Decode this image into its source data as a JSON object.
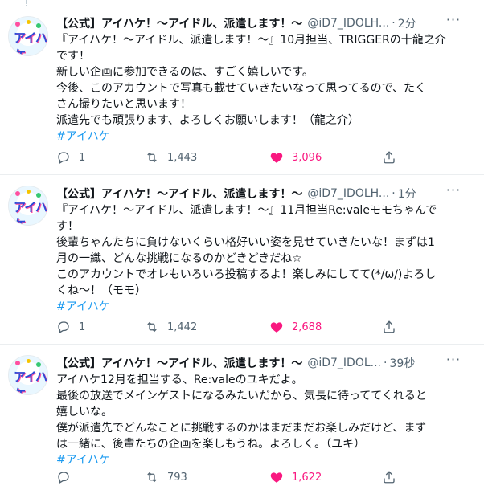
{
  "tweets": [
    {
      "name": "【公式】アイハケ！〜アイドル、派遣します！〜",
      "handle": "@iD7_IDOLH...",
      "sep": "·",
      "time": "2分",
      "lines": [
        "『アイハケ！〜アイドル、派遣します！〜』10月担当、TRIGGERの十龍之介",
        "です！",
        "新しい企画に参加できるのは、すごく嬉しいです。",
        "今後、このアカウントで写真も載せていきたいなって思ってるので、たく",
        "さん撮りたいと思います！",
        "派遣先でも頑張ります、よろしくお願いします！（龍之介）"
      ],
      "hashtag": "#アイハケ",
      "replies": "1",
      "retweets": "1,443",
      "likes": "3,096"
    },
    {
      "name": "【公式】アイハケ！〜アイドル、派遣します！〜",
      "handle": "@iD7_IDOLH...",
      "sep": "·",
      "time": "1分",
      "lines": [
        "『アイハケ！〜アイドル、派遣します！〜』11月担当Re:valeモモちゃんで",
        "す！",
        "後輩ちゃんたちに負けないくらい格好いい姿を見せていきたいな！まずは1",
        "月の一織、どんな挑戦になるのかどきどきだね☆",
        "このアカウントでオレもいろいろ投稿するよ！楽しみにしてて(*/ω/)よろし",
        "くね〜！（モモ）"
      ],
      "hashtag": "#アイハケ",
      "replies": "1",
      "retweets": "1,442",
      "likes": "2,688"
    },
    {
      "name": "【公式】アイハケ！〜アイドル、派遣します！〜",
      "handle": "@iD7_IDOL...",
      "sep": "·",
      "time": "39秒",
      "lines": [
        "アイハケ12月を担当する、Re:valeのユキだよ。",
        "最後の放送でメインゲストになるみたいだから、気長に待っててくれると",
        "嬉しいな。",
        "僕が派遣先でどんなことに挑戦するのかはまだまだお楽しみだけど、まず",
        "は一緒に、後輩たちの企画を楽しもうね。よろしく。（ユキ）"
      ],
      "hashtag": "#アイハケ",
      "replies": "",
      "retweets": "793",
      "likes": "1,622"
    }
  ],
  "avatar": {
    "logo_text": "アイハケ",
    "colors": [
      "#2b4ad6",
      "#ff4fa0",
      "#f6c400",
      "#37c871"
    ]
  },
  "colors": {
    "accent": "#1d9bf0",
    "like": "#f91880",
    "muted": "#536471",
    "divider": "#ebeef0"
  }
}
